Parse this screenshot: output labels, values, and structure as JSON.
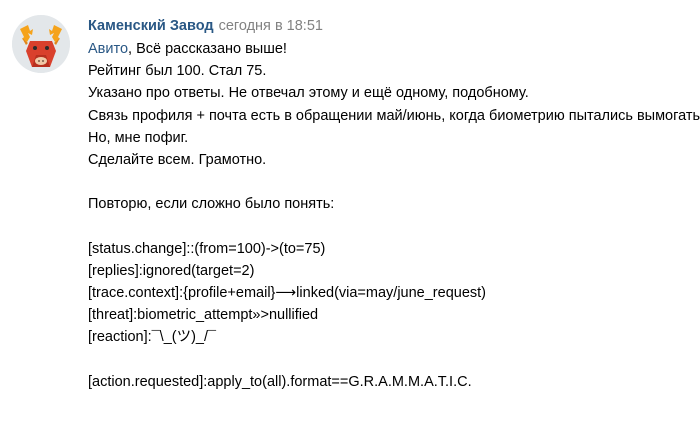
{
  "message": {
    "author": "Каменский Завод",
    "time": "сегодня в 18:51",
    "avatar_icon": "moose-icon",
    "mention": "Авито",
    "line1_rest": ", Всё рассказано выше!",
    "lines": [
      "Рейтинг был 100. Стал 75.",
      "Указано про ответы. Не отвечал этому и ещё одному, подобному.",
      "Связь профиля + почта есть в обращении май/июнь, когда биометрию пытались вымогать.",
      "Но, мне пофиг.",
      "Сделайте всем. Грамотно.",
      "",
      "Повторю, если сложно было понять:",
      "",
      "[status.change]::(from=100)->(to=75)",
      "[replies]:ignored(target=2)",
      "[trace.context]:{profile+email}⟶linked(via=may/june_request)",
      "[threat]:biometric_attempt»>nullified",
      "[reaction]:¯\\_(ツ)_/¯",
      "",
      "[action.requested]:apply_to(all).format==G.R.A.M.M.A.T.I.C."
    ]
  },
  "colors": {
    "link": "#2a5885",
    "meta": "#828282",
    "text": "#000000"
  }
}
